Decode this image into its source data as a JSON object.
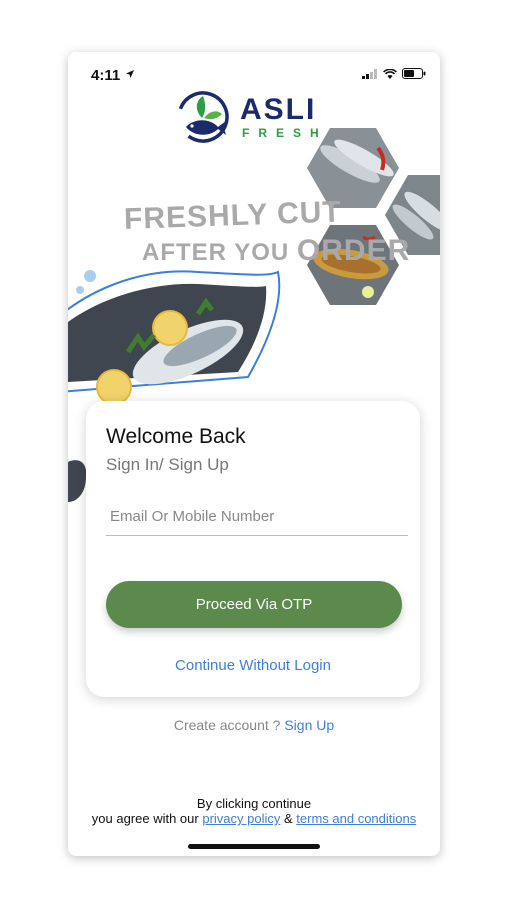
{
  "status_bar": {
    "time": "4:11"
  },
  "brand": {
    "name": "ASLI",
    "tagline": "FRESH",
    "primary_color": "#1b2a6b",
    "accent_color": "#2e9e44"
  },
  "hero": {
    "line1": "FRESHLY CUT",
    "line2_a": "AFTER YOU ",
    "line2_b": "ORDER"
  },
  "login": {
    "title": "Welcome Back",
    "subtitle": "Sign In/ Sign Up",
    "input_placeholder": "Email Or Mobile Number",
    "input_value": "",
    "otp_button": "Proceed Via OTP",
    "skip_link": "Continue Without Login",
    "button_color": "#5b8a4c"
  },
  "signup": {
    "prefix": "Create account ? ",
    "link": "Sign Up"
  },
  "legal": {
    "line1": "By clicking continue",
    "line2_prefix": "you agree with our ",
    "privacy": "privacy policy",
    "amp": " & ",
    "terms": "terms and conditions"
  }
}
